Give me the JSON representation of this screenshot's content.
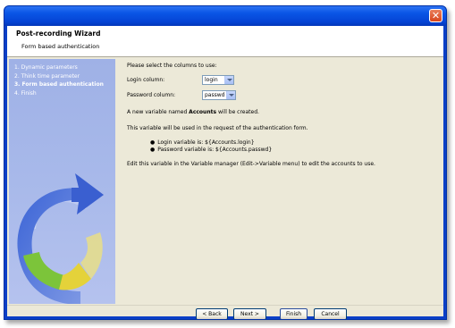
{
  "window": {
    "title": ""
  },
  "header": {
    "title": "Post-recording Wizard",
    "subtitle": "Form based authentication"
  },
  "steps": [
    {
      "label": "1. Dynamic parameters"
    },
    {
      "label": "2. Think time parameter"
    },
    {
      "label": "3. Form based authentication"
    },
    {
      "label": "4. Finish"
    }
  ],
  "content": {
    "intro": "Please select the columns to use:",
    "login_label": "Login column:",
    "login_value": "login",
    "password_label": "Password column:",
    "password_value": "passwd",
    "created_prefix": "A new variable named ",
    "created_name": "Accounts",
    "created_suffix": " will be created.",
    "usage": "This variable will be used in the request of the authentication form.",
    "bullets": [
      "Login variable is: ${Accounts.login}",
      "Password variable is: ${Accounts.passwd}"
    ],
    "edit_hint": "Edit this variable in the Variable manager (Edit->Variable menu) to edit the accounts to use."
  },
  "buttons": {
    "back": "< Back",
    "next": "Next >",
    "finish": "Finish",
    "cancel": "Cancel"
  },
  "colors": {
    "titlebar": "#0a56e6",
    "sidebar": "#a8b9ea",
    "panel": "#ece9d8",
    "close": "#d8451c"
  }
}
